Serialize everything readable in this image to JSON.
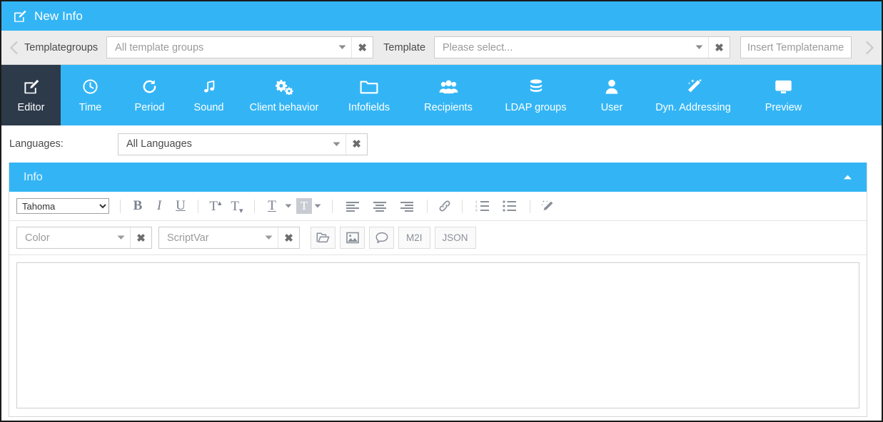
{
  "window": {
    "title": "New Info",
    "title_icon": "edit-square-icon",
    "accent_color": "#33b5f5",
    "active_tab_color": "#2d3a4a"
  },
  "template_bar": {
    "prev_icon": "chevron-left-icon",
    "next_icon": "chevron-right-icon",
    "templategroups_label": "Templategroups",
    "templategroups_value": "All template groups",
    "template_label": "Template",
    "template_value": "Please select...",
    "templatename_placeholder": "Insert Templatename",
    "templatename_value": "",
    "caret_icon": "caret-down-icon",
    "clear_icon": "clear-x-icon"
  },
  "nav": {
    "items": [
      {
        "label": "Editor",
        "icon": "edit-square-icon",
        "active": true
      },
      {
        "label": "Time",
        "icon": "clock-icon",
        "active": false
      },
      {
        "label": "Period",
        "icon": "refresh-icon",
        "active": false
      },
      {
        "label": "Sound",
        "icon": "music-note-icon",
        "active": false
      },
      {
        "label": "Client behavior",
        "icon": "cogs-icon",
        "active": false
      },
      {
        "label": "Infofields",
        "icon": "folder-icon",
        "active": false
      },
      {
        "label": "Recipients",
        "icon": "users-icon",
        "active": false
      },
      {
        "label": "LDAP groups",
        "icon": "database-icon",
        "active": false
      },
      {
        "label": "User",
        "icon": "user-icon",
        "active": false
      },
      {
        "label": "Dyn. Addressing",
        "icon": "magic-wand-icon",
        "active": false
      },
      {
        "label": "Preview",
        "icon": "monitor-icon",
        "active": false
      }
    ]
  },
  "languages": {
    "label": "Languages:",
    "value": "All Languages",
    "caret_icon": "caret-down-icon",
    "clear_icon": "clear-x-icon"
  },
  "info_panel": {
    "title": "Info",
    "collapse_icon": "chevron-up-icon"
  },
  "editor_toolbar": {
    "font_family_value": "Tahoma",
    "font_family_options": [
      "Tahoma"
    ],
    "bold_label": "B",
    "italic_label": "I",
    "underline_label": "U",
    "superscript_label": "T",
    "subscript_label": "T",
    "text_color_label": "T",
    "highlight_color_label": "T",
    "align_left_icon": "align-left-icon",
    "align_center_icon": "align-center-icon",
    "align_right_icon": "align-right-icon",
    "link_icon": "link-chain-icon",
    "ordered_list_icon": "numbered-list-icon",
    "unordered_list_icon": "bullet-list-icon",
    "clear_format_icon": "magic-wand-icon",
    "caret_icon": "caret-down-icon"
  },
  "editor_toolbar_row2": {
    "color_value": "Color",
    "scriptvar_value": "ScriptVar",
    "open_file_icon": "open-folder-icon",
    "insert_image_icon": "image-icon",
    "comment_icon": "speech-bubble-icon",
    "m2i_label": "M2I",
    "json_label": "JSON",
    "caret_icon": "caret-down-icon",
    "clear_icon": "clear-x-icon"
  },
  "editor_content": {
    "value": ""
  }
}
